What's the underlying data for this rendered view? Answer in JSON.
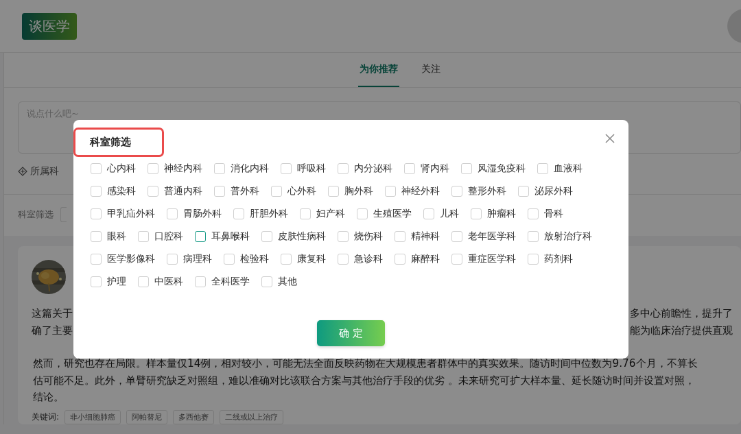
{
  "header": {
    "logo": "谈医学"
  },
  "tabs": [
    {
      "label": "为你推荐",
      "selected": true
    },
    {
      "label": "关注",
      "selected": false
    }
  ],
  "composer": {
    "placeholder": "说点什么吧~",
    "department_label": "所属科"
  },
  "filter_bar": {
    "label": "科室筛选"
  },
  "post": {
    "lines": [
      {
        "left": "这篇关于",
        "right": "多中心前瞻性，提升了"
      },
      {
        "left": "确了主要",
        "right": "能为临床治疗提供直观"
      },
      {
        "left": "然而，研究也存在局限。样本量仅14例，相对较小，可能无法全面反映药物在大规模患者群体中的真实效果。随访时间中位数为9.76个月，不算长"
      },
      {
        "left": "估可能不足。此外，单臂研究缺乏对照组，难以准确对比该联合方案与其他治疗手段的优劣 。未来研究可扩大样本量、延长随访时间并设置对照，"
      },
      {
        "left": "结论。"
      }
    ],
    "keywords_label": "关键词:",
    "keywords": [
      "非小细胞肺癌",
      "阿帕替尼",
      "多西他赛",
      "二线或以上治疗"
    ]
  },
  "dialog": {
    "title": "科室筛选",
    "confirm": "确 定",
    "options": [
      [
        {
          "label": "心内科",
          "checked": false,
          "hovered": false
        },
        {
          "label": "神经内科",
          "checked": false,
          "hovered": false
        },
        {
          "label": "消化内科",
          "checked": false,
          "hovered": false
        },
        {
          "label": "呼吸科",
          "checked": false,
          "hovered": false
        },
        {
          "label": "内分泌科",
          "checked": false,
          "hovered": false
        },
        {
          "label": "肾内科",
          "checked": false,
          "hovered": false
        },
        {
          "label": "风湿免疫科",
          "checked": false,
          "hovered": false
        },
        {
          "label": "血液科",
          "checked": false,
          "hovered": false
        }
      ],
      [
        {
          "label": "感染科",
          "checked": false,
          "hovered": false
        },
        {
          "label": "普通内科",
          "checked": false,
          "hovered": false
        },
        {
          "label": "普外科",
          "checked": false,
          "hovered": false
        },
        {
          "label": "心外科",
          "checked": false,
          "hovered": false
        },
        {
          "label": "胸外科",
          "checked": false,
          "hovered": false
        },
        {
          "label": "神经外科",
          "checked": false,
          "hovered": false
        },
        {
          "label": "整形外科",
          "checked": false,
          "hovered": false
        },
        {
          "label": "泌尿外科",
          "checked": false,
          "hovered": false
        }
      ],
      [
        {
          "label": "甲乳疝外科",
          "checked": false,
          "hovered": false
        },
        {
          "label": "胃肠外科",
          "checked": false,
          "hovered": false
        },
        {
          "label": "肝胆外科",
          "checked": false,
          "hovered": false
        },
        {
          "label": "妇产科",
          "checked": false,
          "hovered": false
        },
        {
          "label": "生殖医学",
          "checked": false,
          "hovered": false
        },
        {
          "label": "儿科",
          "checked": false,
          "hovered": false
        },
        {
          "label": "肿瘤科",
          "checked": false,
          "hovered": false
        },
        {
          "label": "骨科",
          "checked": false,
          "hovered": false
        }
      ],
      [
        {
          "label": "眼科",
          "checked": false,
          "hovered": false
        },
        {
          "label": "口腔科",
          "checked": false,
          "hovered": false
        },
        {
          "label": "耳鼻喉科",
          "checked": false,
          "hovered": true
        },
        {
          "label": "皮肤性病科",
          "checked": false,
          "hovered": false
        },
        {
          "label": "烧伤科",
          "checked": false,
          "hovered": false
        },
        {
          "label": "精神科",
          "checked": false,
          "hovered": false
        },
        {
          "label": "老年医学科",
          "checked": false,
          "hovered": false
        },
        {
          "label": "放射治疗科",
          "checked": false,
          "hovered": false
        }
      ],
      [
        {
          "label": "医学影像科",
          "checked": false,
          "hovered": false
        },
        {
          "label": "病理科",
          "checked": false,
          "hovered": false
        },
        {
          "label": "检验科",
          "checked": false,
          "hovered": false
        },
        {
          "label": "康复科",
          "checked": false,
          "hovered": false
        },
        {
          "label": "急诊科",
          "checked": false,
          "hovered": false
        },
        {
          "label": "麻醉科",
          "checked": false,
          "hovered": false
        },
        {
          "label": "重症医学科",
          "checked": false,
          "hovered": false
        },
        {
          "label": "药剂科",
          "checked": false,
          "hovered": false
        }
      ],
      [
        {
          "label": "护理",
          "checked": false,
          "hovered": false
        },
        {
          "label": "中医科",
          "checked": false,
          "hovered": false
        },
        {
          "label": "全科医学",
          "checked": false,
          "hovered": false
        },
        {
          "label": "其他",
          "checked": false,
          "hovered": false
        }
      ]
    ]
  }
}
